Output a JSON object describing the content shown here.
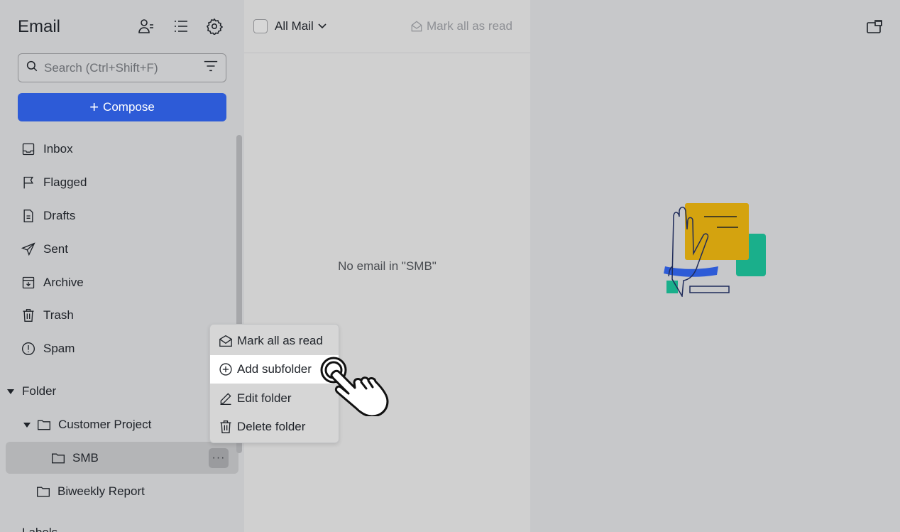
{
  "sidebar": {
    "title": "Email",
    "search_placeholder": "Search (Ctrl+Shift+F)",
    "compose_plus": "+",
    "compose_label": "Compose",
    "items": [
      {
        "label": "Inbox",
        "icon": "inbox-icon"
      },
      {
        "label": "Flagged",
        "icon": "flag-icon"
      },
      {
        "label": "Drafts",
        "icon": "draft-icon"
      },
      {
        "label": "Sent",
        "icon": "send-icon"
      },
      {
        "label": "Archive",
        "icon": "archive-icon"
      },
      {
        "label": "Trash",
        "icon": "trash-icon"
      },
      {
        "label": "Spam",
        "icon": "spam-icon"
      }
    ],
    "folder_section": "Folder",
    "folders": [
      {
        "label": "Customer Project"
      },
      {
        "label": "SMB"
      },
      {
        "label": "Biweekly Report"
      }
    ],
    "more_label": "···",
    "next_section_partial": "Labels"
  },
  "list": {
    "filter_label": "All Mail",
    "mark_all_read": "Mark all as read",
    "empty_message": "No email in \"SMB\""
  },
  "context_menu": {
    "items": [
      {
        "label": "Mark all as read",
        "icon": "envelope-open-icon"
      },
      {
        "label": "Add subfolder",
        "icon": "plus-circle-icon"
      },
      {
        "label": "Edit folder",
        "icon": "pencil-icon"
      },
      {
        "label": "Delete folder",
        "icon": "trash-icon"
      }
    ]
  },
  "colors": {
    "accent": "#2d5bd7",
    "illustration_yellow": "#d4a30f",
    "illustration_teal": "#1aaf8b",
    "illustration_blue": "#2d5bd7"
  }
}
